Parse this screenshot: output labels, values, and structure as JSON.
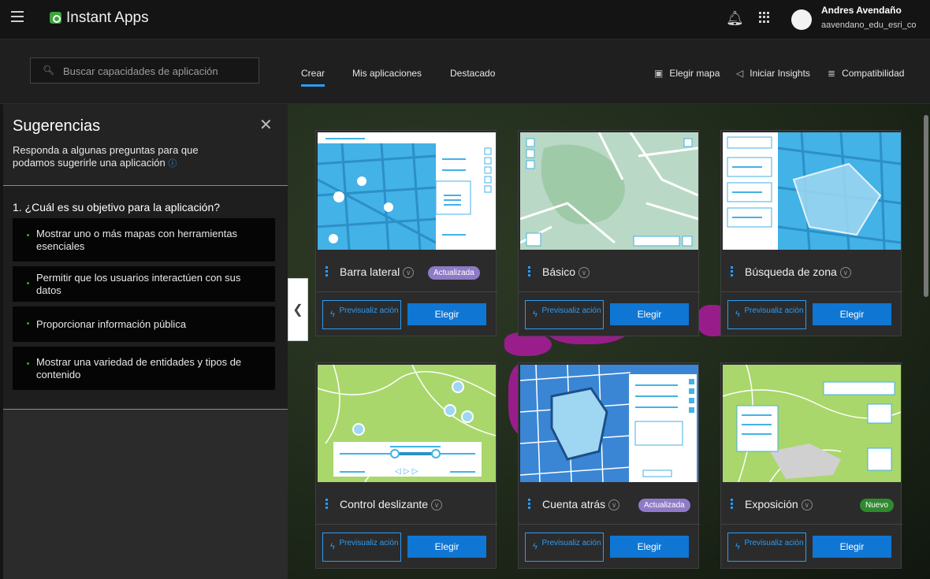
{
  "header": {
    "app_title": "Instant Apps",
    "user_name": "Andres Avendaño",
    "user_id": "aavendano_edu_esri_co",
    "icons": [
      "menu-icon",
      "instant-apps-logo",
      "bell-icon",
      "app-launcher-icon",
      "avatar"
    ]
  },
  "nav": {
    "search_placeholder": "Buscar capacidades de aplicación",
    "tabs": [
      {
        "label": "Crear",
        "active": true
      },
      {
        "label": "Mis aplicaciones",
        "active": false
      },
      {
        "label": "Destacado",
        "active": false
      }
    ],
    "actions": [
      {
        "label": "Elegir mapa",
        "icon": "map-select-icon"
      },
      {
        "label": "Iniciar Insights",
        "icon": "megaphone-icon"
      },
      {
        "label": "Compatibilidad",
        "icon": "filter-lines-icon"
      }
    ]
  },
  "panel": {
    "title": "Sugerencias",
    "description": "Responda a algunas preguntas para que podamos sugerirle una aplicación",
    "question": "1. ¿Cuál es su objetivo para la aplicación?",
    "options": [
      "Mostrar uno o más mapas con herramientas esenciales",
      "Permitir que los usuarios interactúen con sus datos",
      "Proporcionar información pública",
      "Mostrar una variedad de entidades y tipos de contenido"
    ]
  },
  "cards": [
    {
      "name": "Barra lateral",
      "badge": "Actualizada",
      "badge_type": "updated",
      "preview": "Previsualiz ación",
      "choose": "Elegir"
    },
    {
      "name": "Básico",
      "badge": "",
      "badge_type": "",
      "preview": "Previsualiz ación",
      "choose": "Elegir"
    },
    {
      "name": "Búsqueda de zona",
      "badge": "",
      "badge_type": "",
      "preview": "Previsualiz ación",
      "choose": "Elegir"
    },
    {
      "name": "Control deslizante",
      "badge": "",
      "badge_type": "",
      "preview": "Previsualiz ación",
      "choose": "Elegir"
    },
    {
      "name": "Cuenta atrás",
      "badge": "Actualizada",
      "badge_type": "updated",
      "preview": "Previsualiz ación",
      "choose": "Elegir"
    },
    {
      "name": "Exposición",
      "badge": "Nuevo",
      "badge_type": "new",
      "preview": "Previsualiz ación",
      "choose": "Elegir"
    }
  ],
  "colors": {
    "accent": "#2c9cf4",
    "updated_badge": "#8f7ac7",
    "new_badge": "#2f8a2f",
    "choose_button": "#0f76d4"
  }
}
